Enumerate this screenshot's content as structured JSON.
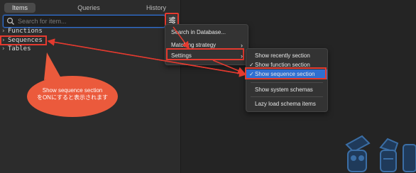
{
  "tabs": [
    {
      "label": "Items",
      "active": true
    },
    {
      "label": "Queries",
      "active": false
    },
    {
      "label": "History",
      "active": false
    }
  ],
  "search": {
    "placeholder": "Search for item..."
  },
  "tree": {
    "items": [
      {
        "label": "Functions"
      },
      {
        "label": "Sequences"
      },
      {
        "label": "Tables"
      }
    ]
  },
  "menu": {
    "items": [
      {
        "label": "Search in Database..."
      },
      {
        "label": "Matching strategy"
      },
      {
        "label": "Settings"
      }
    ]
  },
  "settings_menu": {
    "items": [
      {
        "label": "Show recently section",
        "checked": false
      },
      {
        "label": "Show function section",
        "checked": true
      },
      {
        "label": "Show sequence section",
        "checked": true,
        "selected": true
      },
      {
        "label": "Show system schemas",
        "checked": false
      },
      {
        "label": "Lazy load schema items",
        "checked": false
      }
    ]
  },
  "annotation": {
    "line1": "Show sequence section",
    "line2": "をONにすると表示されます"
  },
  "colors": {
    "highlight": "#e43a2f",
    "accent": "#2f6fd1",
    "bubble": "#eb5a3c"
  },
  "icons": {
    "search": "search-icon",
    "filter": "filter-icon",
    "chevron": "chevron-right-icon",
    "check": "checkmark-icon"
  }
}
